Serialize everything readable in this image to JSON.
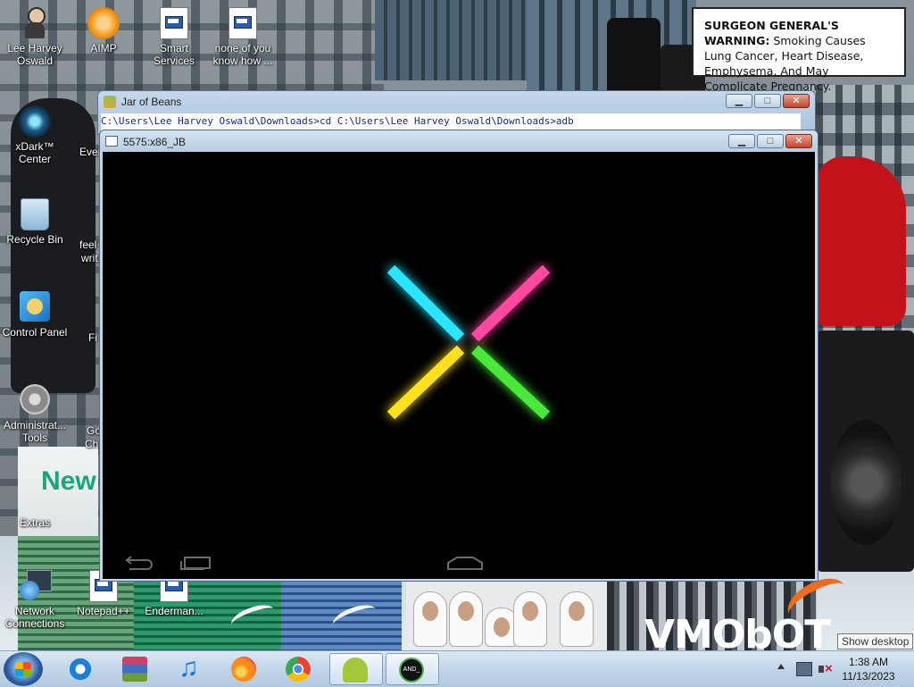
{
  "desktop": {
    "icons": [
      {
        "label_line1": "Lee Harvey",
        "label_line2": "Oswald",
        "icon": "person-icon"
      },
      {
        "label_line1": "AIMP",
        "label_line2": "",
        "icon": "aimp-icon"
      },
      {
        "label_line1": "Smart",
        "label_line2": "Services",
        "icon": "document-icon"
      },
      {
        "label_line1": "none of you",
        "label_line2": "know how ...",
        "icon": "document-icon"
      },
      {
        "label_line1": "xDark™",
        "label_line2": "Center",
        "icon": "xdark-icon"
      },
      {
        "label_line1": "Recycle Bin",
        "label_line2": "",
        "icon": "recycle-bin-icon"
      },
      {
        "label_line1": "Control Panel",
        "label_line2": "",
        "icon": "control-panel-icon"
      },
      {
        "label_line1": "Administrat...",
        "label_line2": "Tools",
        "icon": "admin-tools-icon"
      },
      {
        "label_line1": "Extras",
        "label_line2": "",
        "icon": "folder-icon"
      },
      {
        "label_line1": "Network",
        "label_line2": "Connections",
        "icon": "network-icon"
      },
      {
        "label_line1": "Notepad++",
        "label_line2": "",
        "icon": "document-icon"
      },
      {
        "label_line1": "Enderman...",
        "label_line2": "",
        "icon": "document-icon"
      }
    ],
    "partial_labels": [
      "Ever",
      "feel",
      "writ",
      "Fi",
      "Go",
      "Ch"
    ]
  },
  "wallpaper": {
    "warning_heading": "SURGEON GENERAL'S WARNING:",
    "warning_body": "Smoking Causes Lung Cancer, Heart Disease, Emphysema, And May Complicate Pregnancy.",
    "brand_text": "VMObOT",
    "box_text": "New"
  },
  "windows": {
    "jar": {
      "title": "Jar of Beans",
      "console_text": "C:\\Users\\Lee Harvey Oswald\\Downloads>cd C:\\Users\\Lee Harvey Oswald\\Downloads>adb"
    },
    "emulator": {
      "title": "5575:x86_JB",
      "boot_logo": "nexus-x-boot-logo"
    }
  },
  "taskbar": {
    "apps": [
      {
        "name": "internet-explorer-icon",
        "active": false
      },
      {
        "name": "winrar-icon",
        "active": false
      },
      {
        "name": "music-player-icon",
        "active": false
      },
      {
        "name": "firefox-icon",
        "active": false
      },
      {
        "name": "chrome-icon",
        "active": false
      },
      {
        "name": "android-icon",
        "active": true
      },
      {
        "name": "android-terminal-icon",
        "active": true
      }
    ],
    "android_terminal_label": "AND_",
    "clock_time": "1:38 AM",
    "clock_date": "11/13/2023",
    "show_desktop_tooltip": "Show desktop"
  },
  "colors": {
    "taskbar": "#c2d5e8",
    "close_button": "#c3452e",
    "screen_bg": "#000000",
    "logo_cyan": "#29e5ff",
    "logo_pink": "#ff4aa0",
    "logo_yellow": "#ffe01a",
    "logo_green": "#49e83a"
  }
}
